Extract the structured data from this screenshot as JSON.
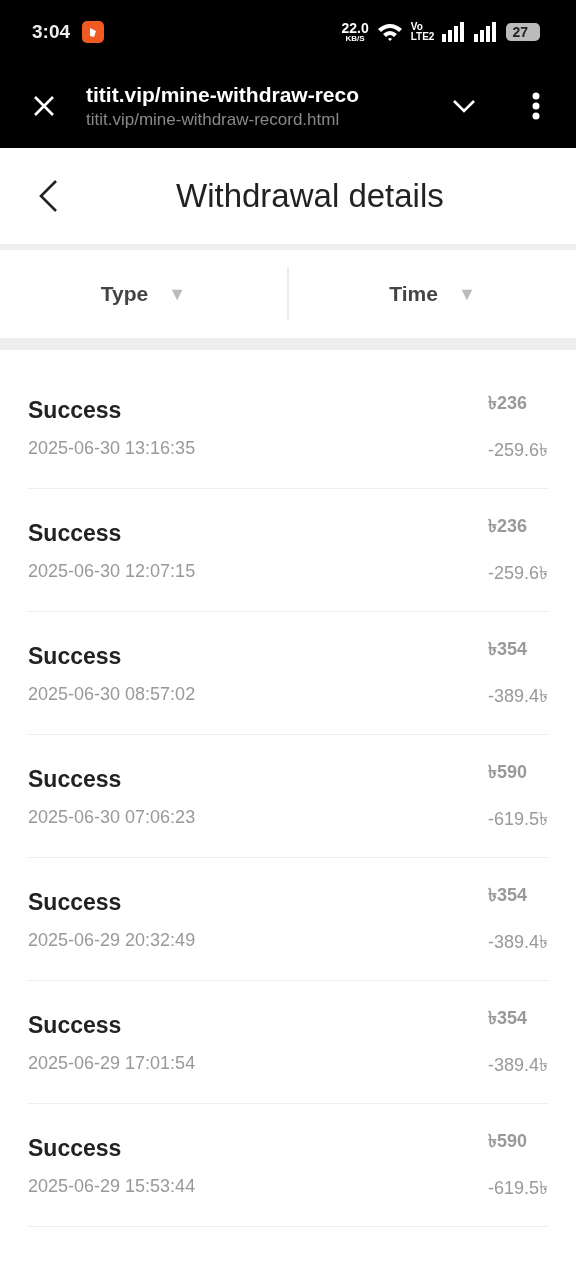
{
  "status_bar": {
    "time": "3:04",
    "speed": "22.0",
    "speed_unit": "KB/S",
    "network_top": "Vo",
    "network_bottom": "LTE2",
    "battery": "27"
  },
  "browser_bar": {
    "title": "titit.vip/mine-withdraw-reco",
    "url": "titit.vip/mine-withdraw-record.html"
  },
  "header": {
    "title": "Withdrawal details"
  },
  "filters": [
    {
      "label": "Type",
      "arrow": "▼"
    },
    {
      "label": "Time",
      "arrow": "▼"
    }
  ],
  "records": [
    {
      "status": "Success",
      "time": "2025-06-30 13:16:35",
      "amount": "৳236",
      "fee": "-259.6৳"
    },
    {
      "status": "Success",
      "time": "2025-06-30 12:07:15",
      "amount": "৳236",
      "fee": "-259.6৳"
    },
    {
      "status": "Success",
      "time": "2025-06-30 08:57:02",
      "amount": "৳354",
      "fee": "-389.4৳"
    },
    {
      "status": "Success",
      "time": "2025-06-30 07:06:23",
      "amount": "৳590",
      "fee": "-619.5৳"
    },
    {
      "status": "Success",
      "time": "2025-06-29 20:32:49",
      "amount": "৳354",
      "fee": "-389.4৳"
    },
    {
      "status": "Success",
      "time": "2025-06-29 17:01:54",
      "amount": "৳354",
      "fee": "-389.4৳"
    },
    {
      "status": "Success",
      "time": "2025-06-29 15:53:44",
      "amount": "৳590",
      "fee": "-619.5৳"
    }
  ]
}
